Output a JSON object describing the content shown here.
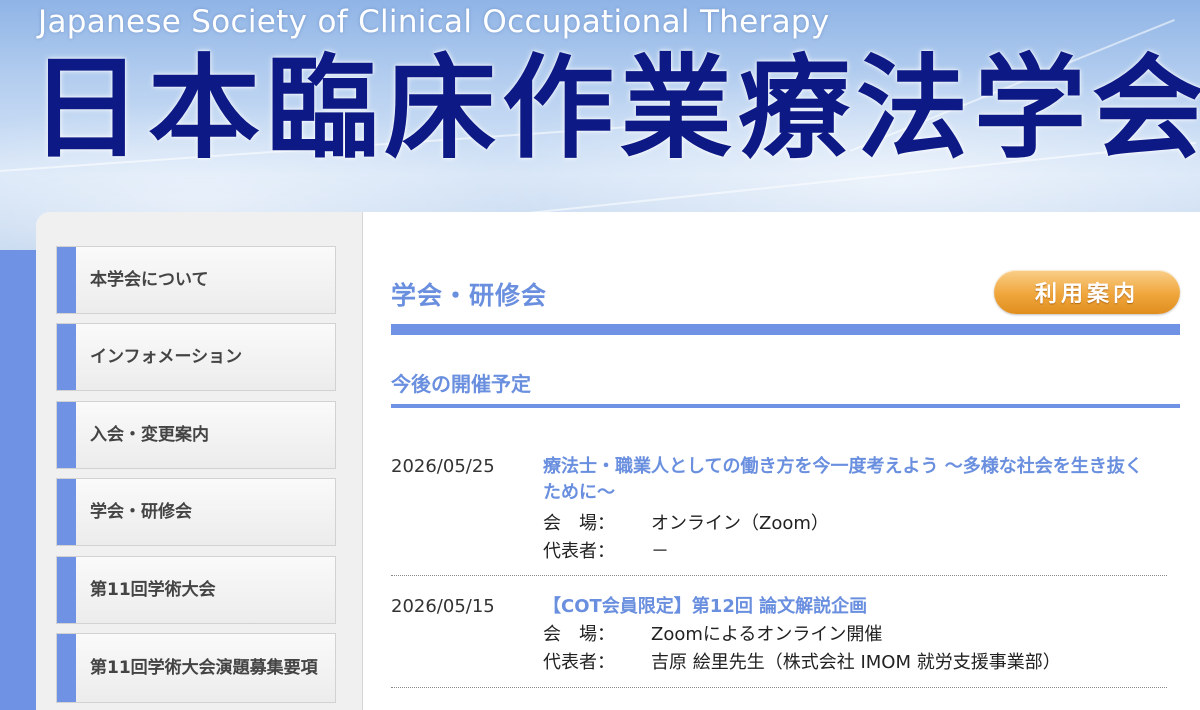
{
  "header": {
    "english_name": "Japanese Society of Clinical Occupational Therapy",
    "japanese_name": "日本臨床作業療法学会"
  },
  "sidebar": {
    "items": [
      {
        "label": "本学会について"
      },
      {
        "label": "インフォメーション"
      },
      {
        "label": "入会・変更案内"
      },
      {
        "label": "学会・研修会"
      },
      {
        "label": "第11回学術大会"
      },
      {
        "label": "第11回学術大会演題募集要項"
      }
    ]
  },
  "main": {
    "section_title": "学会・研修会",
    "guide_button": "利用案内",
    "subsection_title": "今後の開催予定",
    "venue_label": "会　場：",
    "representative_label": "代表者：",
    "events": [
      {
        "date": "2026/05/25",
        "title": "療法士・職業人としての働き方を今一度考えよう 〜多様な社会を生き抜くために〜",
        "venue": "オンライン（Zoom）",
        "representative": "－"
      },
      {
        "date": "2026/05/15",
        "title": "【COT会員限定】第12回 論文解説企画",
        "venue": "Zoomによるオンライン開催",
        "representative": "吉原 絵里先生（株式会社 IMOM 就労支援事業部）"
      }
    ]
  },
  "colors": {
    "accent_blue": "#6f92e5",
    "title_navy": "#0d1a86",
    "button_orange": "#f0a63c"
  }
}
